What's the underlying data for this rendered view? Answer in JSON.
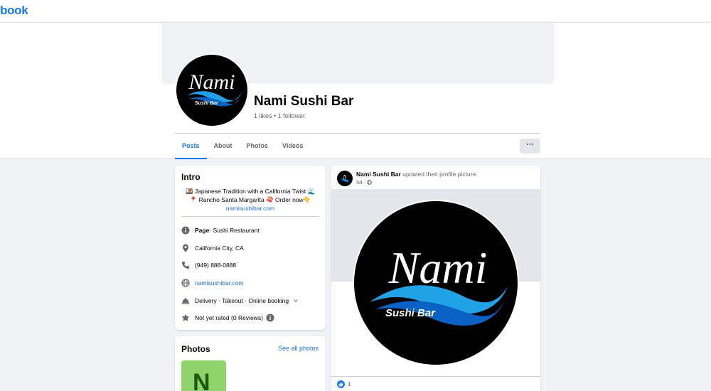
{
  "header": {
    "brand_text": "book"
  },
  "page": {
    "name": "Nami Sushi Bar",
    "stats": "1 likes • 1 follower",
    "logo_text": "Nami",
    "logo_subtext": "Sushi Bar"
  },
  "tabs": [
    {
      "label": "Posts",
      "active": true
    },
    {
      "label": "About",
      "active": false
    },
    {
      "label": "Photos",
      "active": false
    },
    {
      "label": "Videos",
      "active": false
    }
  ],
  "more_label": "···",
  "intro": {
    "title": "Intro",
    "bio_line1": "🍱 Japanese Tradition with a California Twist 🌊",
    "bio_line2": "📍 Rancho Santa Margarita 🍣 Order now👇",
    "bio_link": "namisushibar.com",
    "category_bold": "Page",
    "category_rest": " · Sushi Restaurant",
    "location": "California City, CA",
    "phone": "(949) 888-0888",
    "website": "namisushibar.com",
    "services": "Delivery · Takeout · Online booking",
    "rating": "Not yet rated (0 Reviews)"
  },
  "photos": {
    "title": "Photos",
    "see_all": "See all photos",
    "thumb_letter": "N"
  },
  "post": {
    "author": "Nami Sushi Bar",
    "action": " updated their profile picture.",
    "time": "5d",
    "reaction_count": "1"
  },
  "colors": {
    "accent": "#1877f2",
    "link": "#216fdb",
    "wave_light": "#1fa2e6",
    "wave_dark": "#0a62c4"
  }
}
